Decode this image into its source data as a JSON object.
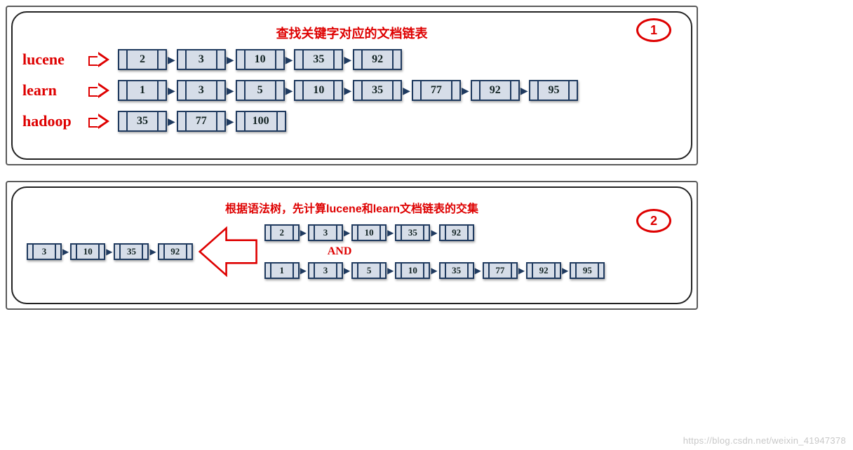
{
  "panel1": {
    "title": "查找关键字对应的文档链表",
    "badge": "1",
    "rows": [
      {
        "keyword": "lucene",
        "docs": [
          2,
          3,
          10,
          35,
          92
        ]
      },
      {
        "keyword": "learn",
        "docs": [
          1,
          3,
          5,
          10,
          35,
          77,
          92,
          95
        ]
      },
      {
        "keyword": "hadoop",
        "docs": [
          35,
          77,
          100
        ]
      }
    ]
  },
  "panel2": {
    "title": "根据语法树，先计算lucene和learn文档链表的交集",
    "badge": "2",
    "operator": "AND",
    "inputA": [
      2,
      3,
      10,
      35,
      92
    ],
    "inputB": [
      1,
      3,
      5,
      10,
      35,
      77,
      92,
      95
    ],
    "result": [
      3,
      10,
      35,
      92
    ]
  },
  "watermark": "https://blog.csdn.net/weixin_41947378"
}
